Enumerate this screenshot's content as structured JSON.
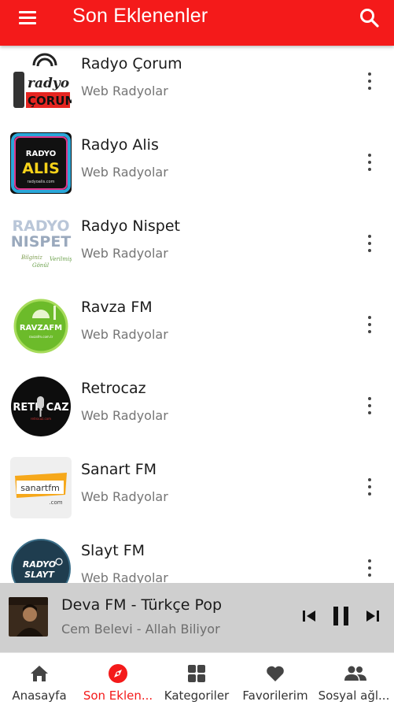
{
  "colors": {
    "primary": "#f41a1a",
    "player_bg": "#cfcfcf",
    "text": "#1b1b1b",
    "secondary_text": "#757575"
  },
  "appbar": {
    "title": "Son Eklenenler",
    "menu_icon": "hamburger-menu-icon",
    "search_icon": "search-icon"
  },
  "stations": [
    {
      "name": "Radyo Çorum",
      "category": "Web Radyolar",
      "logo_text": "radyo ÇORUM"
    },
    {
      "name": "Radyo Alis",
      "category": "Web Radyolar",
      "logo_text": "RADYO ALIS"
    },
    {
      "name": "Radyo Nispet",
      "category": "Web Radyolar",
      "logo_text": "RADYO NISPET"
    },
    {
      "name": "Ravza FM",
      "category": "Web Radyolar",
      "logo_text": "RAVZAFM"
    },
    {
      "name": "Retrocaz",
      "category": "Web Radyolar",
      "logo_text": "RETROCAZ"
    },
    {
      "name": "Sanart FM",
      "category": "Web Radyolar",
      "logo_text": "sanartfm .com"
    },
    {
      "name": "Slayt FM",
      "category": "Web Radyolar",
      "logo_text": "RADYO SLAYT"
    }
  ],
  "player": {
    "title": "Deva FM - Türkçe Pop",
    "subtitle": "Cem Belevi - Allah Biliyor",
    "prev_icon": "skip-previous-icon",
    "pause_icon": "pause-icon",
    "next_icon": "skip-next-icon"
  },
  "bottom_nav": [
    {
      "label": "Anasayfa",
      "icon": "home-icon",
      "active": false
    },
    {
      "label": "Son Eklen...",
      "icon": "compass-icon",
      "active": true
    },
    {
      "label": "Kategoriler",
      "icon": "grid-icon",
      "active": false
    },
    {
      "label": "Favorilerim",
      "icon": "heart-icon",
      "active": false
    },
    {
      "label": "Sosyal ağl...",
      "icon": "people-icon",
      "active": false
    }
  ]
}
